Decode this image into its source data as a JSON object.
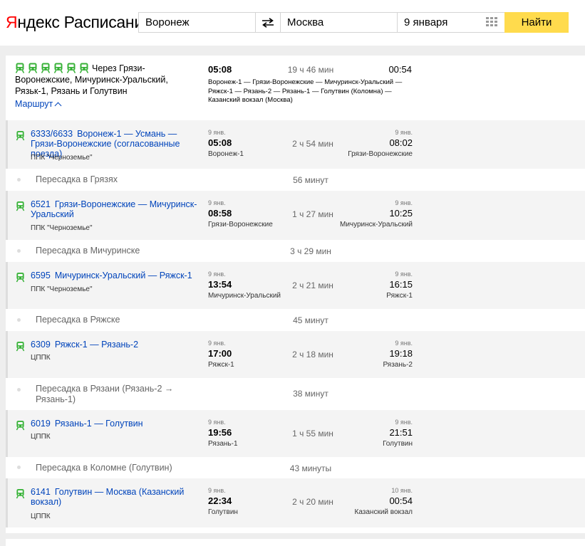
{
  "header": {
    "logo_red": "Я",
    "logo_black": "ндекс",
    "logo_sub": "Расписания",
    "from_value": "Воронеж",
    "to_value": "Москва",
    "date_value": "9 января",
    "find_label": "Найти"
  },
  "summary": {
    "via_text": "Через Грязи-Воронежские, Мичуринск-Уральский, Рязьк-1, Рязань и Голутвин",
    "route_link": "Маршрут",
    "departure": "05:08",
    "duration": "19 ч 46 мин",
    "arrival": "00:54",
    "path": "Воронеж-1 — Грязи-Воронежские — Мичуринск-Уральский — Ряжск-1 — Рязань-2 — Рязань-1 — Голутвин (Коломна) — Казанский вокзал (Москва)"
  },
  "segments": [
    {
      "number": "6333/6633",
      "name": "Воронеж-1 — Усмань — Грязи-Воронежские (согласованные поезда)",
      "carrier": "ППК \"Черноземье\"",
      "dep_date": "9 янв.",
      "dep_time": "05:08",
      "dep_station": "Воронеж-1",
      "duration": "2 ч 54 мин",
      "arr_date": "9 янв.",
      "arr_time": "08:02",
      "arr_station": "Грязи-Воронежские"
    },
    {
      "number": "6521",
      "name": "Грязи-Воронежские — Мичуринск-Уральский",
      "carrier": "ППК \"Черноземье\"",
      "dep_date": "9 янв.",
      "dep_time": "08:58",
      "dep_station": "Грязи-Воронежские",
      "duration": "1 ч 27 мин",
      "arr_date": "9 янв.",
      "arr_time": "10:25",
      "arr_station": "Мичуринск-Уральский"
    },
    {
      "number": "6595",
      "name": "Мичуринск-Уральский — Ряжск-1",
      "carrier": "ППК \"Черноземье\"",
      "dep_date": "9 янв.",
      "dep_time": "13:54",
      "dep_station": "Мичуринск-Уральский",
      "duration": "2 ч 21 мин",
      "arr_date": "9 янв.",
      "arr_time": "16:15",
      "arr_station": "Ряжск-1"
    },
    {
      "number": "6309",
      "name": "Ряжск-1 — Рязань-2",
      "carrier": "ЦППК",
      "dep_date": "9 янв.",
      "dep_time": "17:00",
      "dep_station": "Ряжск-1",
      "duration": "2 ч 18 мин",
      "arr_date": "9 янв.",
      "arr_time": "19:18",
      "arr_station": "Рязань-2"
    },
    {
      "number": "6019",
      "name": "Рязань-1 — Голутвин",
      "carrier": "ЦППК",
      "dep_date": "9 янв.",
      "dep_time": "19:56",
      "dep_station": "Рязань-1",
      "duration": "1 ч 55 мин",
      "arr_date": "9 янв.",
      "arr_time": "21:51",
      "arr_station": "Голутвин"
    },
    {
      "number": "6141",
      "name": "Голутвин — Москва (Казанский вокзал)",
      "carrier": "ЦППК",
      "dep_date": "9 янв.",
      "dep_time": "22:34",
      "dep_station": "Голутвин",
      "duration": "2 ч 20 мин",
      "arr_date": "10 янв.",
      "arr_time": "00:54",
      "arr_station": "Казанский вокзал"
    }
  ],
  "transfers": [
    {
      "label": "Пересадка в Грязях",
      "duration": "56 минут"
    },
    {
      "label": "Пересадка в Мичуринске",
      "duration": "3 ч 29 мин"
    },
    {
      "label": "Пересадка в Ряжске",
      "duration": "45 минут"
    },
    {
      "label": "Пересадка в Рязани (Рязань-2 → Рязань-1)",
      "duration": "38 минут"
    },
    {
      "label": "Пересадка в Коломне (Голутвин)",
      "duration": "43 минуты"
    }
  ],
  "colors": {
    "train_green": "#38b238",
    "link_blue": "#0044bb",
    "find_yellow": "#ffdb4d",
    "logo_red": "#ff0000"
  },
  "icons": {
    "train": "train-icon",
    "swap": "swap-icon",
    "calendar": "calendar-icon"
  }
}
